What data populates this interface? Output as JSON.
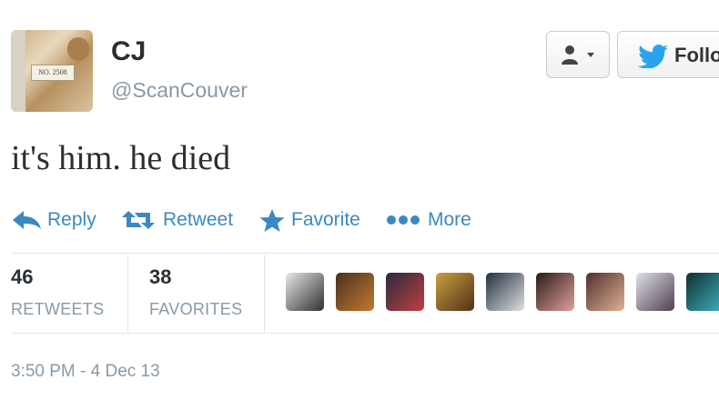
{
  "profile": {
    "name": "CJ",
    "handle": "@ScanCouver",
    "avatar_card_text": "NO. 2508"
  },
  "header_buttons": {
    "follow_label": "Follo"
  },
  "tweet": {
    "text": "it's him. he died"
  },
  "actions": [
    {
      "label": "Reply",
      "icon": "reply-icon"
    },
    {
      "label": "Retweet",
      "icon": "retweet-icon"
    },
    {
      "label": "Favorite",
      "icon": "star-icon"
    },
    {
      "label": "More",
      "icon": "more-dots-icon"
    }
  ],
  "stats": {
    "retweets_count": "46",
    "retweets_label": "RETWEETS",
    "favorites_count": "38",
    "favorites_label": "FAVORITES"
  },
  "favoriters": [
    {
      "name": "favoriter-1",
      "colors": [
        "#e8e8e8",
        "#303030"
      ]
    },
    {
      "name": "favoriter-2",
      "colors": [
        "#4a3020",
        "#c07a30"
      ]
    },
    {
      "name": "favoriter-3",
      "colors": [
        "#2a2a40",
        "#c04040"
      ]
    },
    {
      "name": "favoriter-4",
      "colors": [
        "#c8a040",
        "#503018"
      ]
    },
    {
      "name": "favoriter-5",
      "colors": [
        "#203040",
        "#e0e0e0"
      ]
    },
    {
      "name": "favoriter-6",
      "colors": [
        "#2a1a14",
        "#e0a0a0"
      ]
    },
    {
      "name": "favoriter-7",
      "colors": [
        "#503030",
        "#e0b090"
      ]
    },
    {
      "name": "favoriter-8",
      "colors": [
        "#e0e0e8",
        "#504050"
      ]
    },
    {
      "name": "favoriter-9",
      "colors": [
        "#103030",
        "#40b0c0"
      ]
    }
  ],
  "timestamp": "3:50 PM - 4 Dec 13",
  "colors": {
    "accent": "#3b88c3",
    "muted": "#8899a6",
    "text": "#292f33"
  }
}
